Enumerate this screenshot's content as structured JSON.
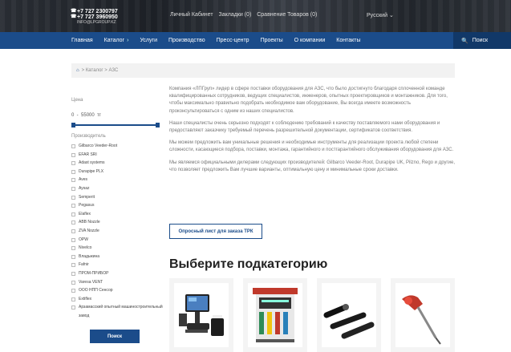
{
  "header": {
    "phones": [
      "+7 727 2300797",
      "+7 727 3960950"
    ],
    "email": "INFO@LPGROUP.KZ",
    "links": [
      "Личный Кабинет",
      "Закладки (0)",
      "Сравнение Товаров (0)"
    ],
    "language": "Русский"
  },
  "nav": {
    "items": [
      "Главная",
      "Каталог",
      "Услуги",
      "Производство",
      "Пресс-центр",
      "Проекты",
      "О компании",
      "Контакты"
    ],
    "search_label": "Поиск"
  },
  "breadcrumb": {
    "items": [
      "Каталог",
      "АЗС"
    ],
    "separator": ">"
  },
  "sidebar": {
    "price_title": "Цена",
    "price_min": "0",
    "price_max": "55000",
    "price_unit": "тг",
    "makers_title": "Производитель",
    "makers": [
      "Gilbarco Veeder-Root",
      "EFAR SRI",
      "Adast systems",
      "Durapipe PLX",
      "Aves",
      "Aysaz",
      "Semperit",
      "Pegasus",
      "Elaflex",
      "ABB Nozzle",
      "ZVA Nozzle",
      "OPW",
      "Nivelco",
      "Владыкина",
      "Fafnir",
      "ПРОМ-ПРИБОР",
      "Varesa VENT",
      "ООО НПП Сенсор",
      "Extiflex",
      "Арзамасский опытный машиностроительный завод"
    ],
    "search_button": "Поиск"
  },
  "content": {
    "paragraphs": [
      "Компания «ЛПГруп» лидер в сфере поставки оборудования для АЗС, что было достигнуто благодаря сплоченной команде квалифицированных сотрудников, ведущих специалистов, инженеров, опытных проектировщиков и монтажников. Для того, чтобы максимально правильно подобрать необходимое вам оборудование, Вы всегда имеете возможность проконсультироваться с одним из наших специалистов.",
      "Наши специалисты очень серьезно подходят к соблюдению требований к качеству поставляемого нами оборудования и предоставляют заказчику требуемый перечень разрешительной документации, сертификатов соответствия.",
      "Мы можем предложить вам уникальные решения и необходимые инструменты для реализации проекта любой степени сложности, касающиеся подбора, поставки, монтажа, гарантийного и постгарантийного обслуживания оборудования для АЗС.",
      "Мы являемся официальными дилерами следующих производителей: Gilbarco Veeder-Root, Durapipe UK, Pilzno, Rego и другие, что позволяет предложить Вам лучшие варианты, оптимальную цену и минимальные сроки доставки."
    ],
    "form_button": "Опросный лист для заказа ТРК",
    "subcategory_title": "Выберите подкатегорию"
  },
  "colors": {
    "brand": "#1b4c8a",
    "brand_dark": "#113868"
  }
}
